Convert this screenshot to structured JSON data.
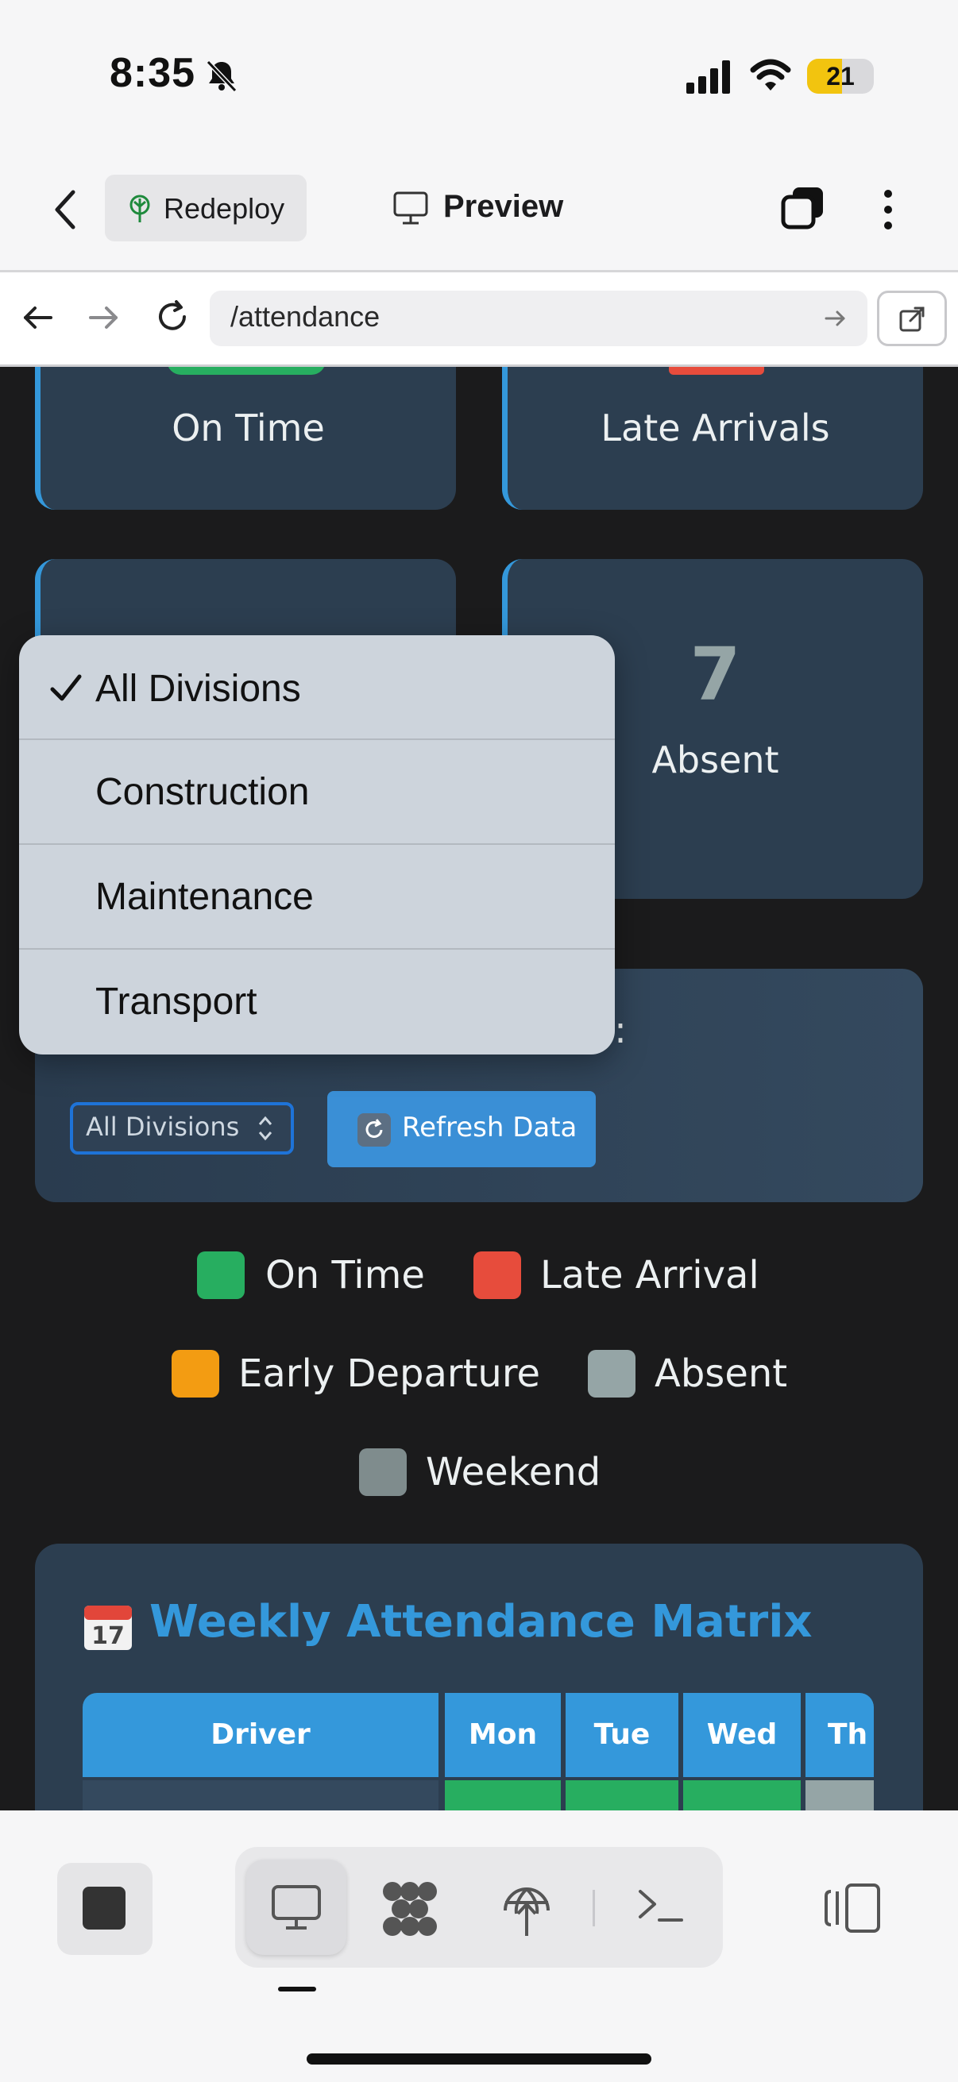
{
  "status_bar": {
    "time": "8:35",
    "battery": "21"
  },
  "app_header": {
    "redeploy_label": "Redeploy",
    "preview_label": "Preview"
  },
  "browser": {
    "url": "/attendance"
  },
  "stats": [
    {
      "label": "On Time",
      "color": "#27ae60"
    },
    {
      "label": "Late Arrivals",
      "color": "#e74c3c"
    },
    {
      "value": "7",
      "label": "Absent",
      "color": "#95a5a6"
    }
  ],
  "filter": {
    "label_visible_fragment": "on:",
    "selected_division": "All Divisions",
    "refresh_label": "Refresh Data",
    "options": [
      "All Divisions",
      "Construction",
      "Maintenance",
      "Transport"
    ]
  },
  "legend": [
    {
      "label": "On Time",
      "color": "#27ae60"
    },
    {
      "label": "Late Arrival",
      "color": "#e74c3c"
    },
    {
      "label": "Early Departure",
      "color": "#f39c12"
    },
    {
      "label": "Absent",
      "color": "#95a5a6"
    },
    {
      "label": "Weekend",
      "color": "#7f8c8d"
    }
  ],
  "matrix": {
    "title": "Weekly Attendance Matrix",
    "columns": [
      "Driver",
      "Mon",
      "Tue",
      "Wed",
      "Th"
    ]
  }
}
